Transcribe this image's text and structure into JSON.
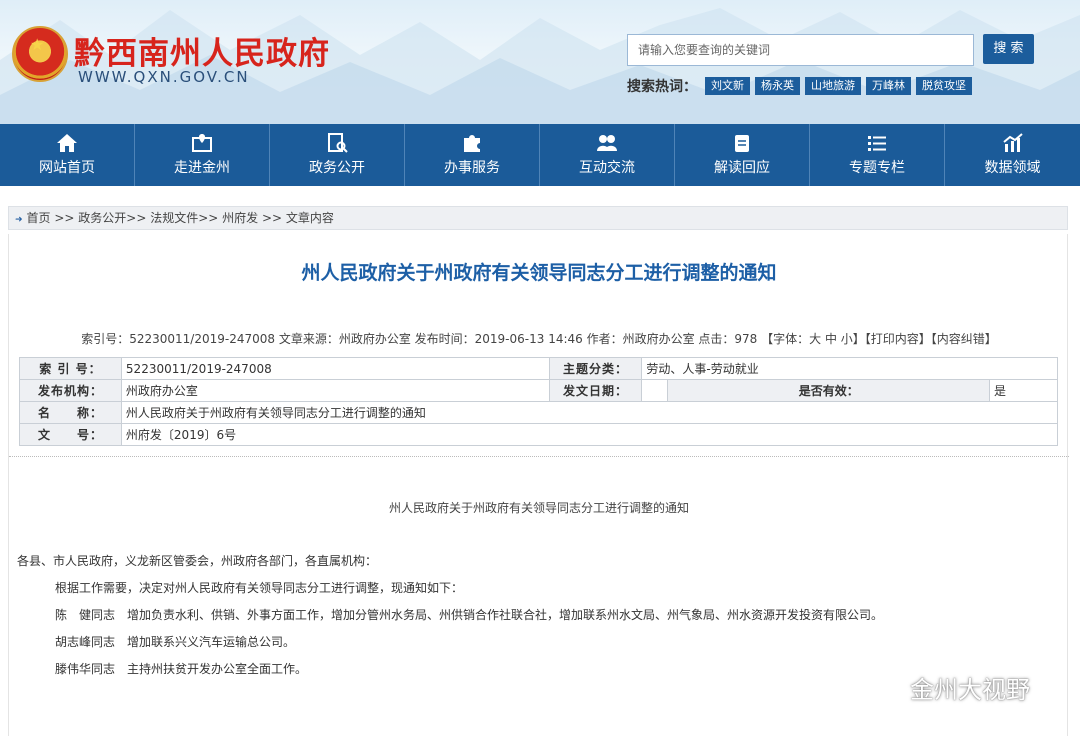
{
  "header": {
    "site_title": "黔西南州人民政府",
    "site_url": "WWW.QXN.GOV.CN",
    "search_placeholder": "请输入您要查询的关键词",
    "search_button": "搜 索",
    "hot_label": "搜索热词：",
    "hot_tags": [
      "刘文新",
      "杨永英",
      "山地旅游",
      "万峰林",
      "脱贫攻坚"
    ]
  },
  "nav": [
    {
      "label": "网站首页",
      "icon": "home-icon"
    },
    {
      "label": "走进金州",
      "icon": "map-pin-icon"
    },
    {
      "label": "政务公开",
      "icon": "document-search-icon"
    },
    {
      "label": "办事服务",
      "icon": "puzzle-icon"
    },
    {
      "label": "互动交流",
      "icon": "people-icon"
    },
    {
      "label": "解读回应",
      "icon": "clipboard-icon"
    },
    {
      "label": "专题专栏",
      "icon": "list-icon"
    },
    {
      "label": "数据领域",
      "icon": "chart-icon"
    }
  ],
  "breadcrumb": "首页 >> 政务公开>> 法规文件>> 州府发 >> 文章内容",
  "article": {
    "title": "州人民政府关于州政府有关领导同志分工进行调整的通知",
    "meta": "索引号：52230011/2019-247008 文章来源：州政府办公室 发布时间：2019-06-13 14:46 作者：州政府办公室 点击：978 【字体：大 中 小】【打印内容】【内容纠错】"
  },
  "info_table": {
    "index_label": "索 引 号：",
    "index_value": "52230011/2019-247008",
    "topic_label": "主题分类：",
    "topic_value": "劳动、人事-劳动就业",
    "org_label": "发布机构：",
    "org_value": "州政府办公室",
    "date_label": "发文日期：",
    "date_value": "",
    "valid_label": "是否有效：",
    "valid_value": "是",
    "name_label": "名　　称：",
    "name_value": "州人民政府关于州政府有关领导同志分工进行调整的通知",
    "doc_label": "文　　号：",
    "doc_value": "州府发〔2019〕6号"
  },
  "body": {
    "title": "州人民政府关于州政府有关领导同志分工进行调整的通知",
    "salutation": "各县、市人民政府，义龙新区管委会，州政府各部门，各直属机构：",
    "paragraphs": [
      "根据工作需要，决定对州人民政府有关领导同志分工进行调整，现通知如下：",
      "陈　健同志　增加负责水利、供销、外事方面工作，增加分管州水务局、州供销合作社联合社，增加联系州水文局、州气象局、州水资源开发投资有限公司。",
      "胡志峰同志　增加联系兴义汽车运输总公司。",
      "滕伟华同志　主持州扶贫开发办公室全面工作。"
    ]
  },
  "watermark": "金州大视野"
}
